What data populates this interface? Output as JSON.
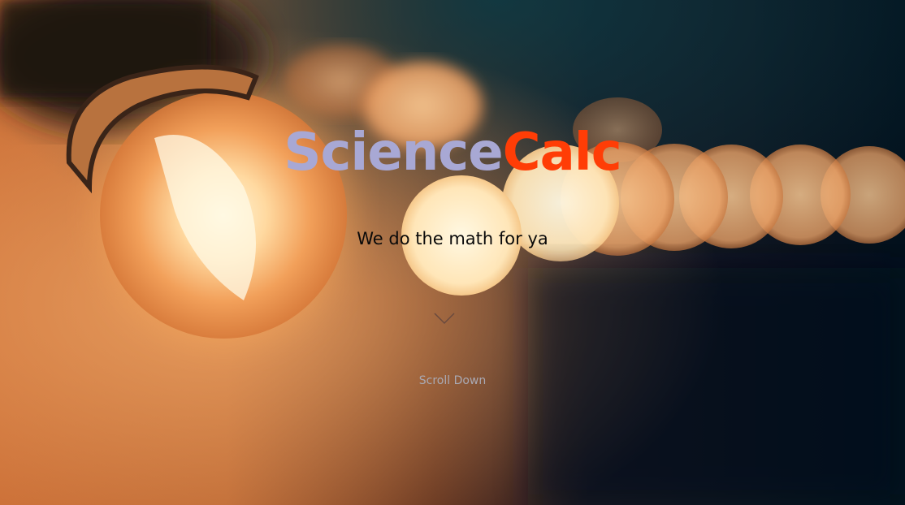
{
  "hero": {
    "title_part1": "Science",
    "title_part2": "Calc",
    "tagline": "We do the math for ya",
    "scroll_label": "Scroll Down",
    "scroll_icon": "chevron-down-icon"
  },
  "colors": {
    "title_part1": "#a8a8d4",
    "title_part2": "#ff3d06",
    "tagline": "#0a0a0a",
    "scroll_label": "#a9a9b3",
    "background_dark": "#02101c",
    "background_warm": "#e8955a"
  }
}
